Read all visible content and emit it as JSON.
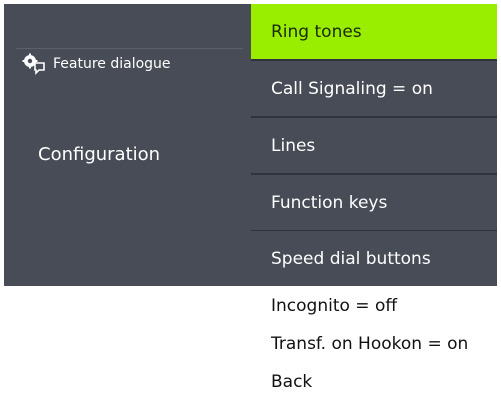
{
  "colors": {
    "panel": "#474c57",
    "separator": "#2f333d",
    "selected": "#99ee00"
  },
  "left": {
    "feature_icon": "feature-dialogue-icon",
    "feature_label": "Feature dialogue",
    "title": "Configuration"
  },
  "menu": {
    "items": [
      {
        "label": "Ring tones",
        "selected": true
      },
      {
        "label": "Call Signaling = on"
      },
      {
        "label": "Lines"
      },
      {
        "label": "Function keys"
      },
      {
        "label": "Speed dial buttons"
      }
    ],
    "overflow_items": [
      {
        "label": "Incognito = off"
      },
      {
        "label": "Transf. on Hookon = on"
      },
      {
        "label": "Back"
      }
    ]
  }
}
